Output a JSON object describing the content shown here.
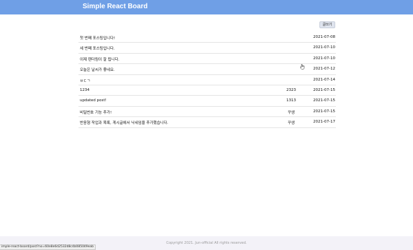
{
  "header": {
    "brand": "Simple React Board"
  },
  "toolbar": {
    "write_label": "글쓰기"
  },
  "posts": [
    {
      "title": "첫 번째 포스팅입니다!",
      "author": "",
      "date": "2021-07-08"
    },
    {
      "title": "세 번째 포스팅입니다.",
      "author": "",
      "date": "2021-07-10"
    },
    {
      "title": "이제 렌더링이 잘 됩니다.",
      "author": "",
      "date": "2021-07-10"
    },
    {
      "title": "오늘은 날씨가 좋네요.",
      "author": "",
      "date": "2021-07-12"
    },
    {
      "title": "ㅂㄷㄱ",
      "author": "",
      "date": "2021-07-14"
    },
    {
      "title": "1234",
      "author": "2323",
      "date": "2021-07-15"
    },
    {
      "title": "updated post!",
      "author": "1313",
      "date": "2021-07-15"
    },
    {
      "title": "비밀번호 기능 추가!",
      "author": "꾸생",
      "date": "2021-07-15"
    },
    {
      "title": "반응형 작업과 목록, 게시글에서 닉네임을 추가했습니다.",
      "author": "꾸생",
      "date": "2021-07-17"
    }
  ],
  "footer": {
    "copyright": "Copyright 2021. Jun-official All rights reserved."
  },
  "status_bar": {
    "url": "imple-react-board/post?no=60e8e6d2532d8c4b085049eab"
  }
}
